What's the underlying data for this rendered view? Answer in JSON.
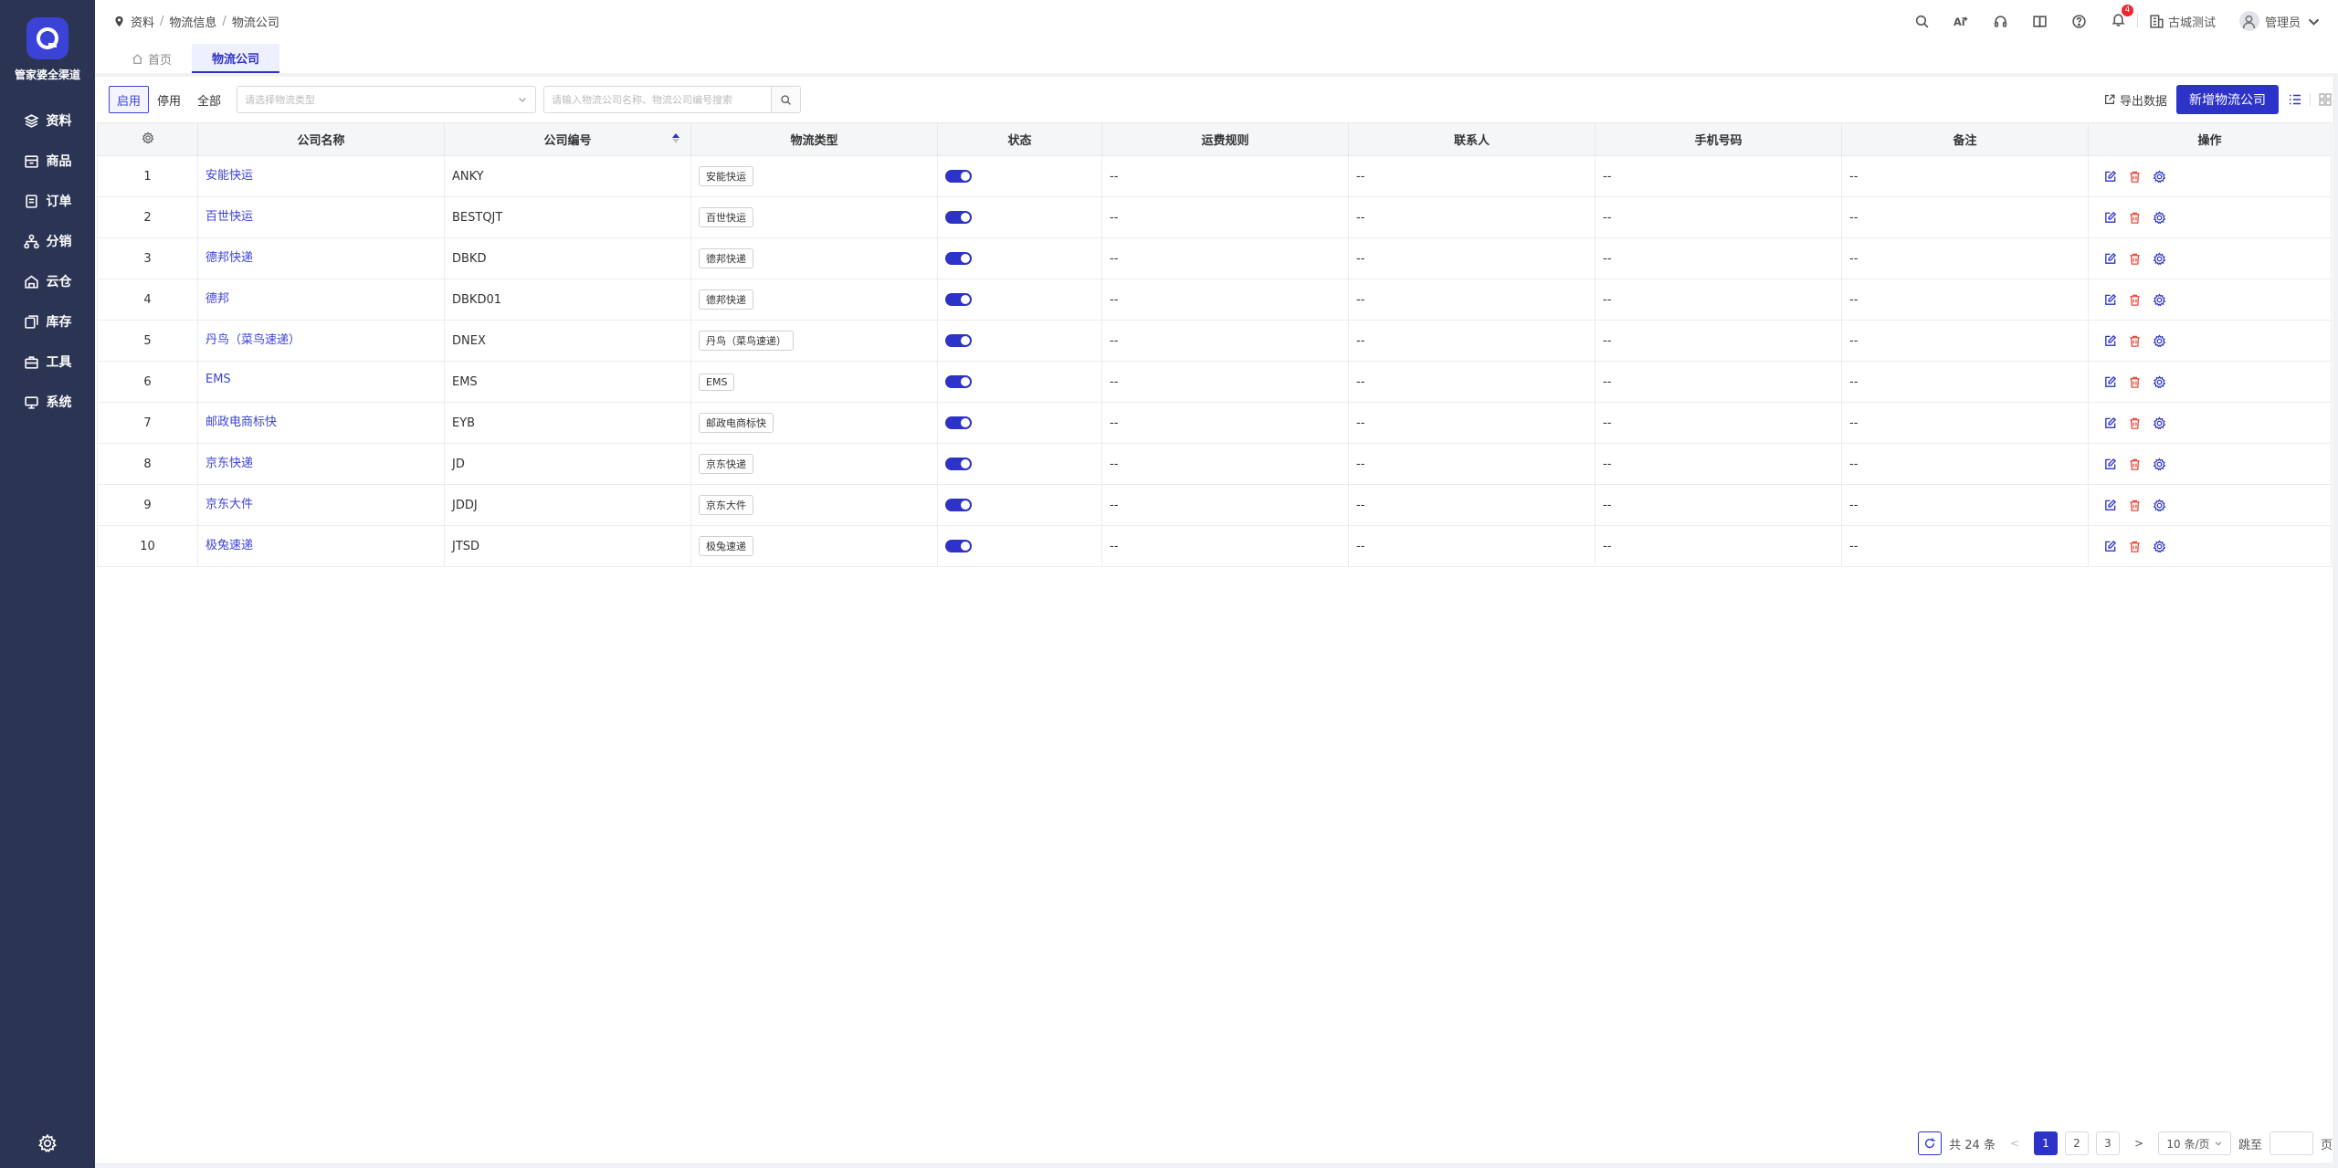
{
  "app": {
    "name": "管家婆全渠道",
    "accent": "#2d32c8",
    "sidebar_bg": "#2b3453"
  },
  "sidebar": {
    "items": [
      {
        "label": "资料",
        "icon": "layers-icon"
      },
      {
        "label": "商品",
        "icon": "box-icon"
      },
      {
        "label": "订单",
        "icon": "order-icon"
      },
      {
        "label": "分销",
        "icon": "network-icon"
      },
      {
        "label": "云仓",
        "icon": "warehouse-icon"
      },
      {
        "label": "库存",
        "icon": "stock-icon"
      },
      {
        "label": "工具",
        "icon": "toolbox-icon"
      },
      {
        "label": "系统",
        "icon": "monitor-icon"
      }
    ]
  },
  "header": {
    "breadcrumb": [
      "资料",
      "物流信息",
      "物流公司"
    ],
    "notification_count": "4",
    "org_name": "古城测试",
    "user_name": "管理员"
  },
  "tabs": [
    {
      "label": "首页",
      "active": false
    },
    {
      "label": "物流公司",
      "active": true
    }
  ],
  "toolbar": {
    "filters": [
      "启用",
      "停用",
      "全部"
    ],
    "active_filter": "启用",
    "type_select_placeholder": "请选择物流类型",
    "search_placeholder": "请输入物流公司名称、物流公司编号搜索",
    "export_label": "导出数据",
    "add_label": "新增物流公司"
  },
  "table": {
    "columns": [
      "",
      "公司名称",
      "公司编号",
      "物流类型",
      "状态",
      "运费规则",
      "联系人",
      "手机号码",
      "备注",
      "操作"
    ],
    "rows": [
      {
        "index": "1",
        "name": "安能快运",
        "code": "ANKY",
        "type": "安能快运",
        "enabled": true,
        "freight": "--",
        "contact": "--",
        "phone": "--",
        "remark": "--"
      },
      {
        "index": "2",
        "name": "百世快运",
        "code": "BESTQJT",
        "type": "百世快运",
        "enabled": true,
        "freight": "--",
        "contact": "--",
        "phone": "--",
        "remark": "--"
      },
      {
        "index": "3",
        "name": "德邦快递",
        "code": "DBKD",
        "type": "德邦快递",
        "enabled": true,
        "freight": "--",
        "contact": "--",
        "phone": "--",
        "remark": "--"
      },
      {
        "index": "4",
        "name": "德邦",
        "code": "DBKD01",
        "type": "德邦快递",
        "enabled": true,
        "freight": "--",
        "contact": "--",
        "phone": "--",
        "remark": "--"
      },
      {
        "index": "5",
        "name": "丹鸟（菜鸟速递）",
        "code": "DNEX",
        "type": "丹鸟（菜鸟速递）",
        "enabled": true,
        "freight": "--",
        "contact": "--",
        "phone": "--",
        "remark": "--"
      },
      {
        "index": "6",
        "name": "EMS",
        "code": "EMS",
        "type": "EMS",
        "enabled": true,
        "freight": "--",
        "contact": "--",
        "phone": "--",
        "remark": "--"
      },
      {
        "index": "7",
        "name": "邮政电商标快",
        "code": "EYB",
        "type": "邮政电商标快",
        "enabled": true,
        "freight": "--",
        "contact": "--",
        "phone": "--",
        "remark": "--"
      },
      {
        "index": "8",
        "name": "京东快递",
        "code": "JD",
        "type": "京东快递",
        "enabled": true,
        "freight": "--",
        "contact": "--",
        "phone": "--",
        "remark": "--"
      },
      {
        "index": "9",
        "name": "京东大件",
        "code": "JDDJ",
        "type": "京东大件",
        "enabled": true,
        "freight": "--",
        "contact": "--",
        "phone": "--",
        "remark": "--"
      },
      {
        "index": "10",
        "name": "极兔速递",
        "code": "JTSD",
        "type": "极兔速递",
        "enabled": true,
        "freight": "--",
        "contact": "--",
        "phone": "--",
        "remark": "--"
      }
    ]
  },
  "pagination": {
    "total_text": "共 24 条",
    "pages": [
      "1",
      "2",
      "3"
    ],
    "current_page": "1",
    "page_size": "10 条/页",
    "jump_label": "跳至",
    "page_suffix": "页"
  }
}
